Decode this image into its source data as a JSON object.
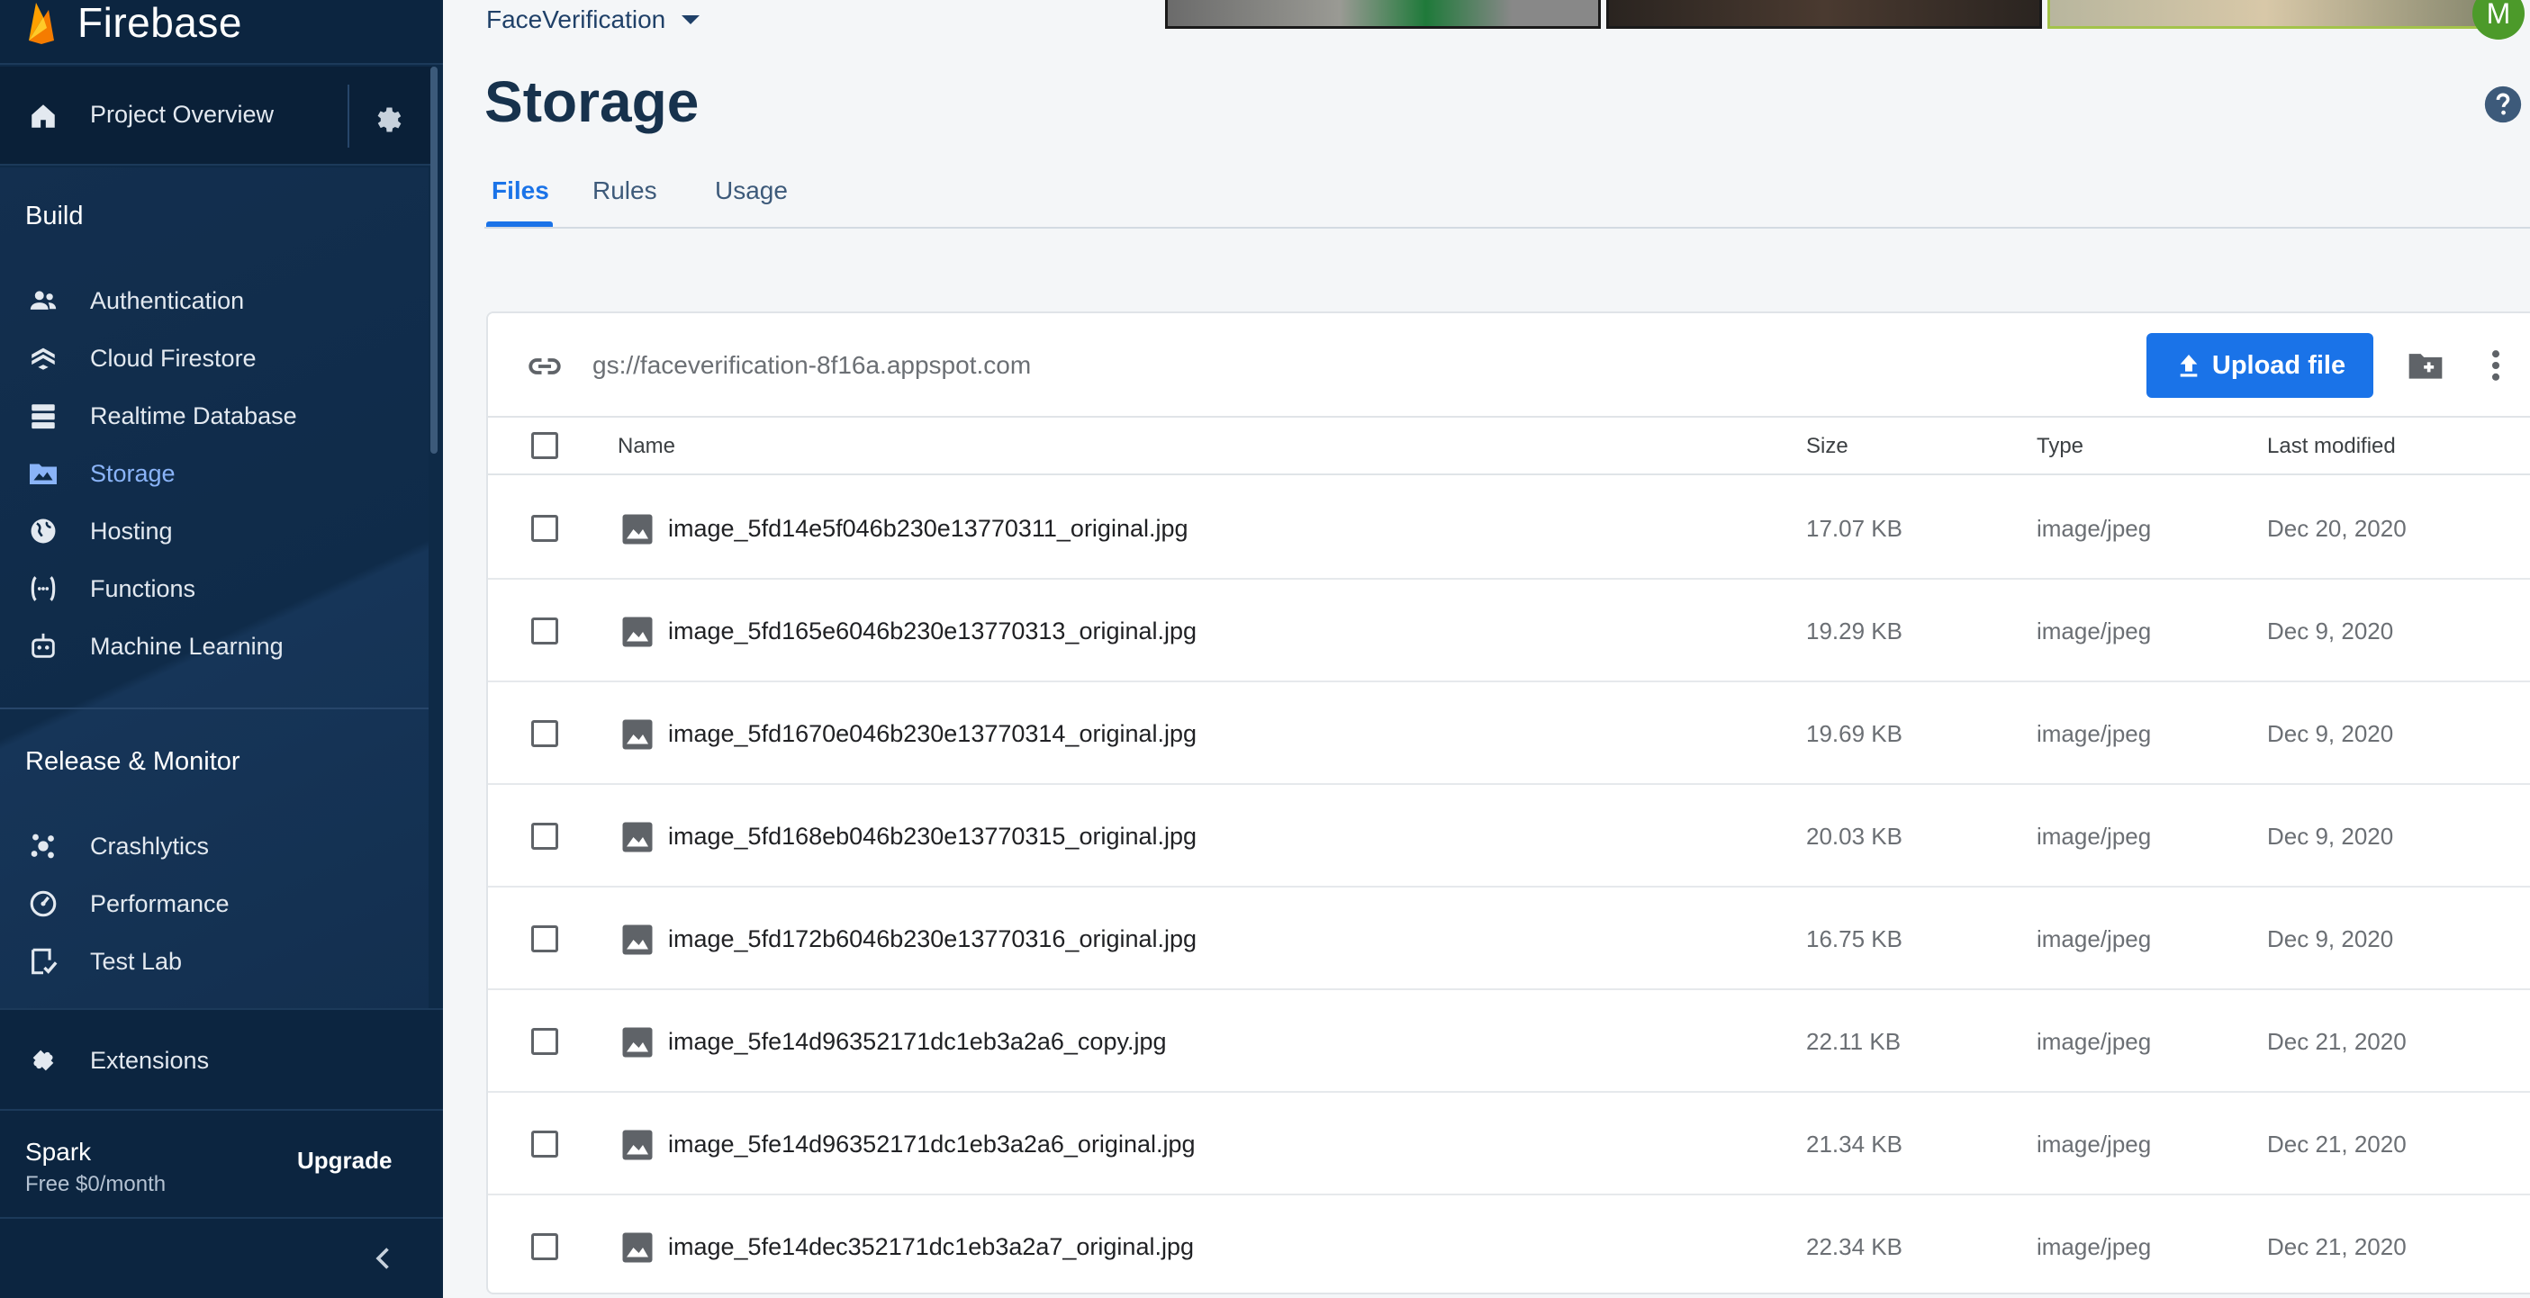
{
  "brand": {
    "name": "Firebase"
  },
  "sidebar": {
    "overview_label": "Project Overview",
    "build_title": "Build",
    "build_items": [
      {
        "label": "Authentication",
        "icon": "people-icon"
      },
      {
        "label": "Cloud Firestore",
        "icon": "firestore-icon"
      },
      {
        "label": "Realtime Database",
        "icon": "database-icon"
      },
      {
        "label": "Storage",
        "icon": "image-folder-icon",
        "active": true
      },
      {
        "label": "Hosting",
        "icon": "globe-icon"
      },
      {
        "label": "Functions",
        "icon": "functions-icon"
      },
      {
        "label": "Machine Learning",
        "icon": "robot-icon"
      }
    ],
    "release_title": "Release & Monitor",
    "release_items": [
      {
        "label": "Crashlytics",
        "icon": "crashlytics-icon"
      },
      {
        "label": "Performance",
        "icon": "speedometer-icon"
      },
      {
        "label": "Test Lab",
        "icon": "checklist-icon"
      }
    ],
    "extensions_label": "Extensions",
    "plan": {
      "name": "Spark",
      "price": "Free $0/month",
      "upgrade": "Upgrade"
    }
  },
  "header": {
    "project_name": "FaceVerification",
    "avatar_letter": "M"
  },
  "page": {
    "title": "Storage",
    "tabs": [
      {
        "label": "Files",
        "active": true
      },
      {
        "label": "Rules"
      },
      {
        "label": "Usage"
      }
    ]
  },
  "storage": {
    "bucket_url": "gs://faceverification-8f16a.appspot.com",
    "upload_label": "Upload file",
    "columns": {
      "name": "Name",
      "size": "Size",
      "type": "Type",
      "modified": "Last modified"
    },
    "files": [
      {
        "name": "image_5fd14e5f046b230e13770311_original.jpg",
        "size": "17.07 KB",
        "type": "image/jpeg",
        "modified": "Dec 20, 2020"
      },
      {
        "name": "image_5fd165e6046b230e13770313_original.jpg",
        "size": "19.29 KB",
        "type": "image/jpeg",
        "modified": "Dec 9, 2020"
      },
      {
        "name": "image_5fd1670e046b230e13770314_original.jpg",
        "size": "19.69 KB",
        "type": "image/jpeg",
        "modified": "Dec 9, 2020"
      },
      {
        "name": "image_5fd168eb046b230e13770315_original.jpg",
        "size": "20.03 KB",
        "type": "image/jpeg",
        "modified": "Dec 9, 2020"
      },
      {
        "name": "image_5fd172b6046b230e13770316_original.jpg",
        "size": "16.75 KB",
        "type": "image/jpeg",
        "modified": "Dec 9, 2020"
      },
      {
        "name": "image_5fe14d96352171dc1eb3a2a6_copy.jpg",
        "size": "22.11 KB",
        "type": "image/jpeg",
        "modified": "Dec 21, 2020"
      },
      {
        "name": "image_5fe14d96352171dc1eb3a2a6_original.jpg",
        "size": "21.34 KB",
        "type": "image/jpeg",
        "modified": "Dec 21, 2020"
      },
      {
        "name": "image_5fe14dec352171dc1eb3a2a7_original.jpg",
        "size": "22.34 KB",
        "type": "image/jpeg",
        "modified": "Dec 21, 2020"
      }
    ]
  },
  "colors": {
    "sidebar_bg": "#0e2a47",
    "active_nav": "#8ab4f8",
    "accent": "#1a73e8",
    "avatar": "#4c9a2a"
  }
}
